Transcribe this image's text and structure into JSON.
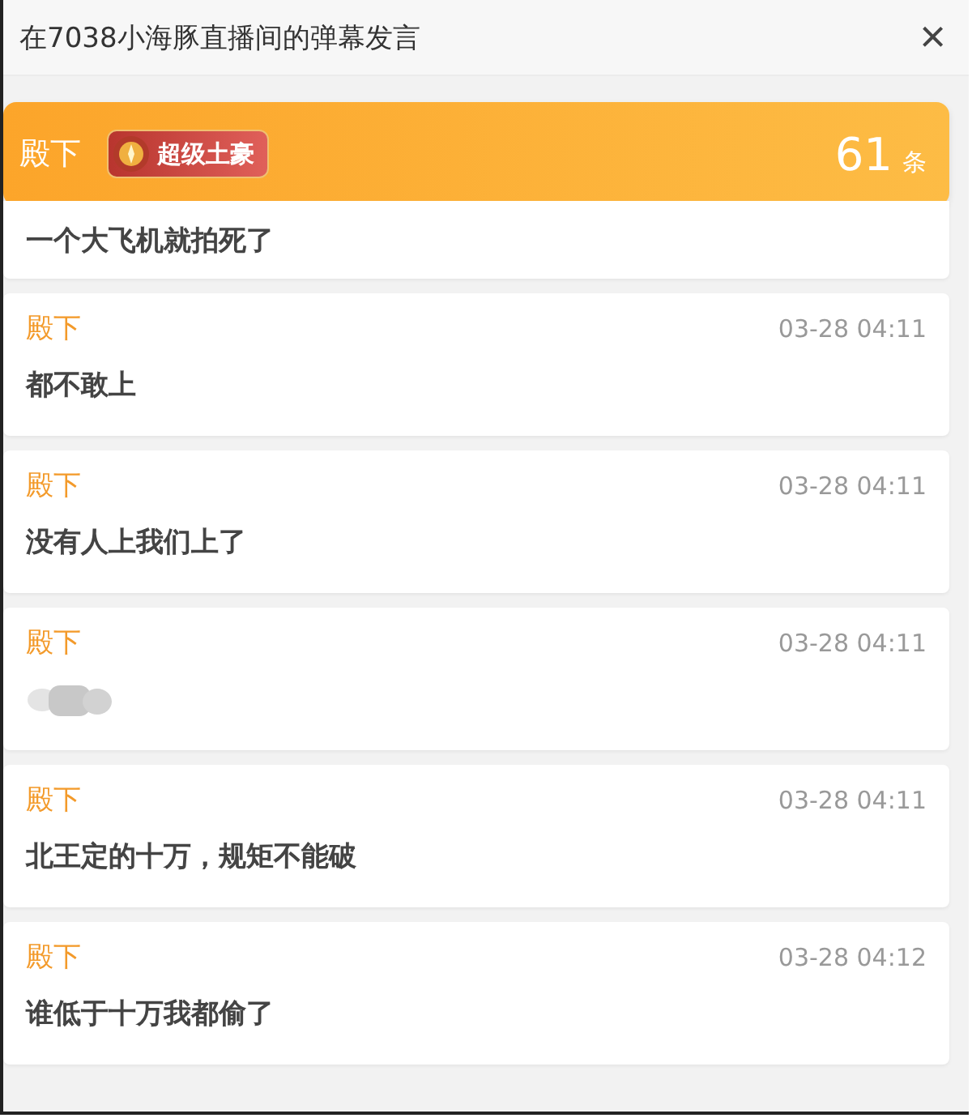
{
  "header": {
    "title": "在7038小海豚直播间的弹幕发言",
    "close": "×"
  },
  "user_banner": {
    "name": "殿下",
    "badge": "超级土豪",
    "count": "61",
    "count_unit": "条"
  },
  "messages": [
    {
      "kind": "cut",
      "text": "一个大飞机就拍死了"
    },
    {
      "kind": "text",
      "name": "殿下",
      "time": "03-28 04:11",
      "text": "都不敢上"
    },
    {
      "kind": "text",
      "name": "殿下",
      "time": "03-28 04:11",
      "text": "没有人上我们上了"
    },
    {
      "kind": "blurred",
      "name": "殿下",
      "time": "03-28 04:11"
    },
    {
      "kind": "text",
      "name": "殿下",
      "time": "03-28 04:11",
      "text": "北王定的十万，规矩不能破"
    },
    {
      "kind": "text",
      "name": "殿下",
      "time": "03-28 04:12",
      "text": "谁低于十万我都偷了"
    }
  ]
}
